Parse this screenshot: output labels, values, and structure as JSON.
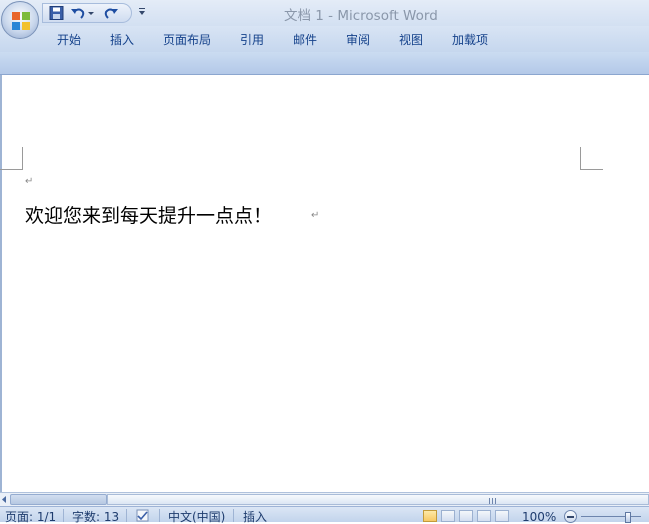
{
  "window": {
    "title": "文档 1 - Microsoft Word"
  },
  "ribbon": {
    "tabs": [
      {
        "label": "开始"
      },
      {
        "label": "插入"
      },
      {
        "label": "页面布局"
      },
      {
        "label": "引用"
      },
      {
        "label": "邮件"
      },
      {
        "label": "审阅"
      },
      {
        "label": "视图"
      },
      {
        "label": "加载项"
      }
    ]
  },
  "quick_access": {
    "icons": [
      "save-icon",
      "undo-icon",
      "undo-dropdown-icon",
      "redo-icon",
      "customize-dropdown-icon"
    ]
  },
  "document": {
    "paragraph_mark": "↵",
    "body_text": "欢迎您来到每天提升一点点！",
    "trailing_mark": "↵"
  },
  "status_bar": {
    "page": "页面: 1/1",
    "word_count": "字数: 13",
    "language": "中文(中国)",
    "mode": "插入",
    "zoom": "100%",
    "zoom_fraction": 0.5
  },
  "colors": {
    "accent": "#15428b",
    "ribbon": "#c6d7ee",
    "status": "#c2d4ec"
  }
}
